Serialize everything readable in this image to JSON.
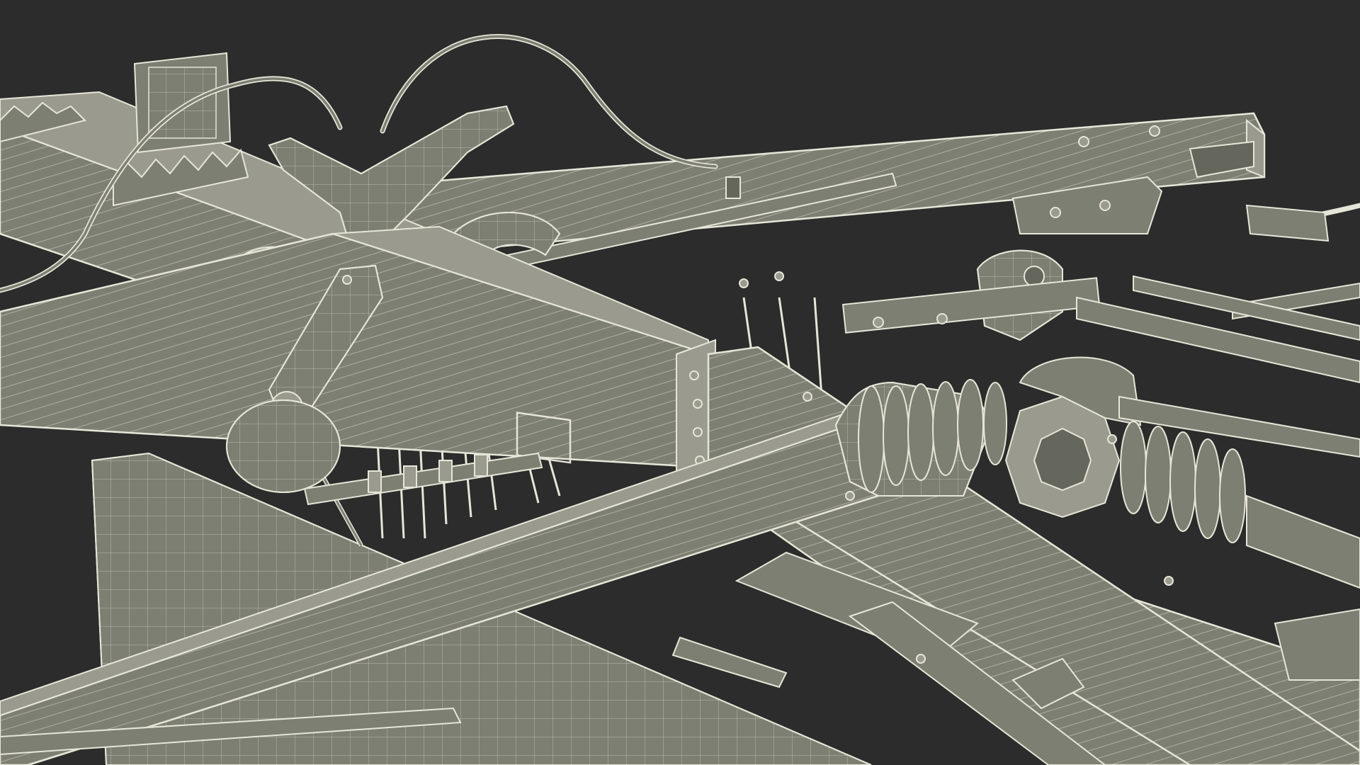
{
  "scene": {
    "background": "#2c2c2c",
    "fill": "#7e7f73",
    "fill_dark": "#65665c",
    "fill_light": "#9a9b8e",
    "wire": "#e6e6d8"
  }
}
